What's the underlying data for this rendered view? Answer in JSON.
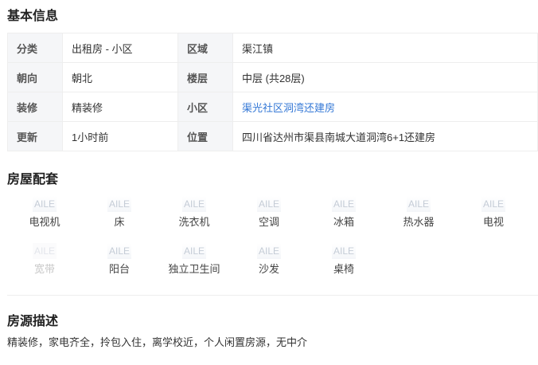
{
  "basic_info": {
    "title": "基本信息",
    "rows": [
      {
        "k1": "分类",
        "v1": "出租房 - 小区",
        "k2": "区域",
        "v2": "渠江镇"
      },
      {
        "k1": "朝向",
        "v1": "朝北",
        "k2": "楼层",
        "v2": "中层 (共28层)"
      },
      {
        "k1": "装修",
        "v1": "精装修",
        "k2": "小区",
        "v2": "渠光社区洞湾还建房"
      },
      {
        "k1": "更新",
        "v1": "1小时前",
        "k2": "位置",
        "v2": "四川省达州市渠县南城大道洞湾6+1还建房"
      }
    ],
    "link_color": "#3478d6"
  },
  "amenities": {
    "title": "房屋配套",
    "icon_placeholder": "AILE",
    "items": [
      {
        "label": "电视机",
        "available": true,
        "icon": "tv-icon"
      },
      {
        "label": "床",
        "available": true,
        "icon": "bed-icon"
      },
      {
        "label": "洗衣机",
        "available": true,
        "icon": "washing-machine-icon"
      },
      {
        "label": "空调",
        "available": true,
        "icon": "air-conditioner-icon"
      },
      {
        "label": "冰箱",
        "available": true,
        "icon": "fridge-icon"
      },
      {
        "label": "热水器",
        "available": true,
        "icon": "water-heater-icon"
      },
      {
        "label": "电视",
        "available": true,
        "icon": "television-icon"
      },
      {
        "label": "宽带",
        "available": false,
        "icon": "broadband-icon"
      },
      {
        "label": "阳台",
        "available": true,
        "icon": "balcony-icon"
      },
      {
        "label": "独立卫生间",
        "available": true,
        "icon": "bathroom-icon"
      },
      {
        "label": "沙发",
        "available": true,
        "icon": "sofa-icon"
      },
      {
        "label": "桌椅",
        "available": true,
        "icon": "table-chair-icon"
      }
    ]
  },
  "description": {
    "title": "房源描述",
    "text": "精装修，家电齐全，拎包入住，离学校近，个人闲置房源，无中介"
  }
}
